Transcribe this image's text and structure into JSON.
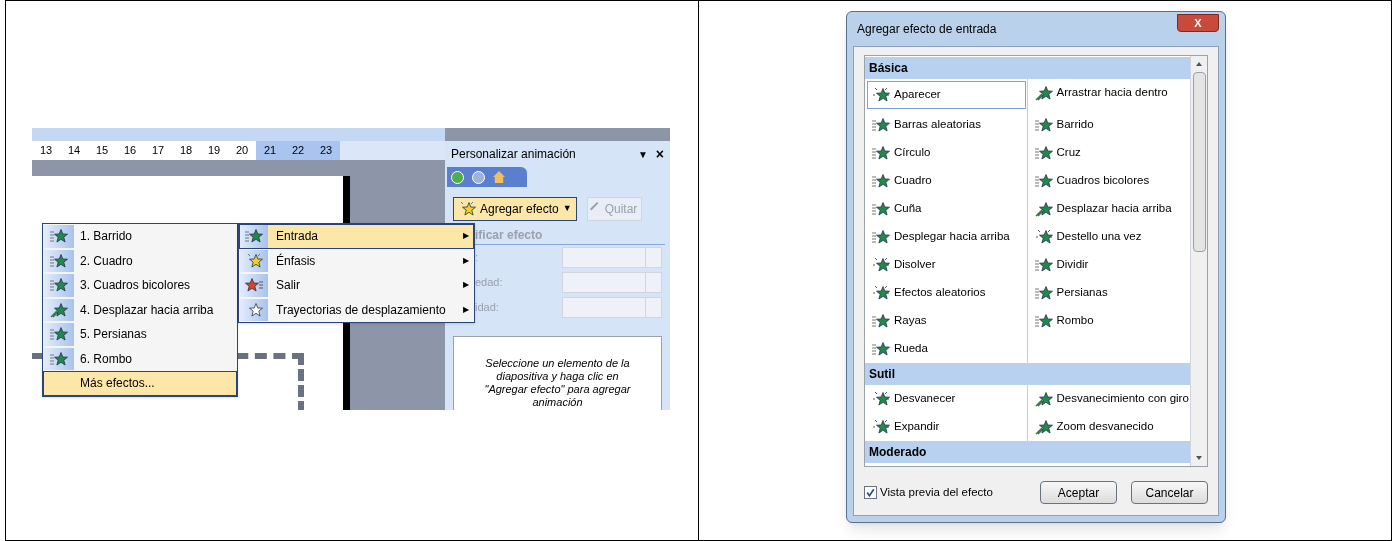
{
  "left_screenshot": {
    "ruler": [
      "13",
      "14",
      "15",
      "16",
      "17",
      "18",
      "19",
      "20",
      "21",
      "22",
      "23"
    ],
    "task_pane": {
      "title": "Personalizar animación",
      "menu_glyph": "▼",
      "close_glyph": "×",
      "add_button": "Agregar efecto",
      "add_caret": "▼",
      "remove_button": {
        "label": "Quitar",
        "disabled": true
      },
      "section": "ificar efecto",
      "fields": [
        {
          "label": ":"
        },
        {
          "label": "edad:"
        },
        {
          "label": "idad:"
        }
      ],
      "hint": "Seleccione un elemento de la diapositiva y haga clic en \"Agregar efecto\" para agregar animación"
    },
    "effects_menu": [
      {
        "label": "1. Barrido",
        "kind": "effect",
        "selected": false
      },
      {
        "label": "2. Cuadro",
        "kind": "effect",
        "selected": false
      },
      {
        "label": "3. Cuadros bicolores",
        "kind": "effect",
        "selected": false
      },
      {
        "label": "4. Desplazar hacia arriba",
        "kind": "flying",
        "selected": false
      },
      {
        "label": "5. Persianas",
        "kind": "effect",
        "selected": false
      },
      {
        "label": "6. Rombo",
        "kind": "effect",
        "selected": false
      },
      {
        "label": "Más efectos...",
        "kind": "more",
        "selected": true
      }
    ],
    "category_menu": [
      {
        "label": "Entrada",
        "kind": "entrance",
        "arrow": "▶",
        "selected": true
      },
      {
        "label": "Énfasis",
        "kind": "emphasis",
        "arrow": "▶",
        "selected": false
      },
      {
        "label": "Salir",
        "kind": "exit",
        "arrow": "▶",
        "selected": false
      },
      {
        "label": "Trayectorias de desplazamiento",
        "kind": "path",
        "arrow": "▶",
        "selected": false
      }
    ]
  },
  "dialog": {
    "title": "Agregar efecto de entrada",
    "close_glyph": "X",
    "sections": [
      {
        "title": "Básica",
        "items": [
          {
            "label": "Aparecer",
            "kind": "sparkle",
            "selected": true
          },
          {
            "label": "Arrastrar hacia dentro",
            "kind": "flying",
            "selected": false
          },
          {
            "label": "Barras aleatorias",
            "kind": "striped",
            "selected": false
          },
          {
            "label": "Barrido",
            "kind": "striped",
            "selected": false
          },
          {
            "label": "Círculo",
            "kind": "striped",
            "selected": false
          },
          {
            "label": "Cruz",
            "kind": "striped",
            "selected": false
          },
          {
            "label": "Cuadro",
            "kind": "striped",
            "selected": false
          },
          {
            "label": "Cuadros bicolores",
            "kind": "striped",
            "selected": false
          },
          {
            "label": "Cuña",
            "kind": "striped",
            "selected": false
          },
          {
            "label": "Desplazar hacia arriba",
            "kind": "flying",
            "selected": false
          },
          {
            "label": "Desplegar hacia arriba",
            "kind": "striped",
            "selected": false
          },
          {
            "label": "Destello una vez",
            "kind": "sparkle",
            "selected": false
          },
          {
            "label": "Disolver",
            "kind": "sparkle",
            "selected": false
          },
          {
            "label": "Dividir",
            "kind": "striped",
            "selected": false
          },
          {
            "label": "Efectos aleatorios",
            "kind": "sparkle",
            "selected": false
          },
          {
            "label": "Persianas",
            "kind": "striped",
            "selected": false
          },
          {
            "label": "Rayas",
            "kind": "striped",
            "selected": false
          },
          {
            "label": "Rombo",
            "kind": "striped",
            "selected": false
          },
          {
            "label": "Rueda",
            "kind": "striped",
            "selected": false
          }
        ]
      },
      {
        "title": "Sutil",
        "items": [
          {
            "label": "Desvanecer",
            "kind": "sparkle",
            "selected": false
          },
          {
            "label": "Desvanecimiento con giro",
            "kind": "flying",
            "selected": false
          },
          {
            "label": "Expandir",
            "kind": "sparkle",
            "selected": false
          },
          {
            "label": "Zoom desvanecido",
            "kind": "flying",
            "selected": false
          }
        ]
      },
      {
        "title": "Moderado"
      }
    ],
    "preview": {
      "label": "Vista previa del efecto",
      "checked": true
    },
    "buttons": [
      "Aceptar",
      "Cancelar"
    ]
  }
}
